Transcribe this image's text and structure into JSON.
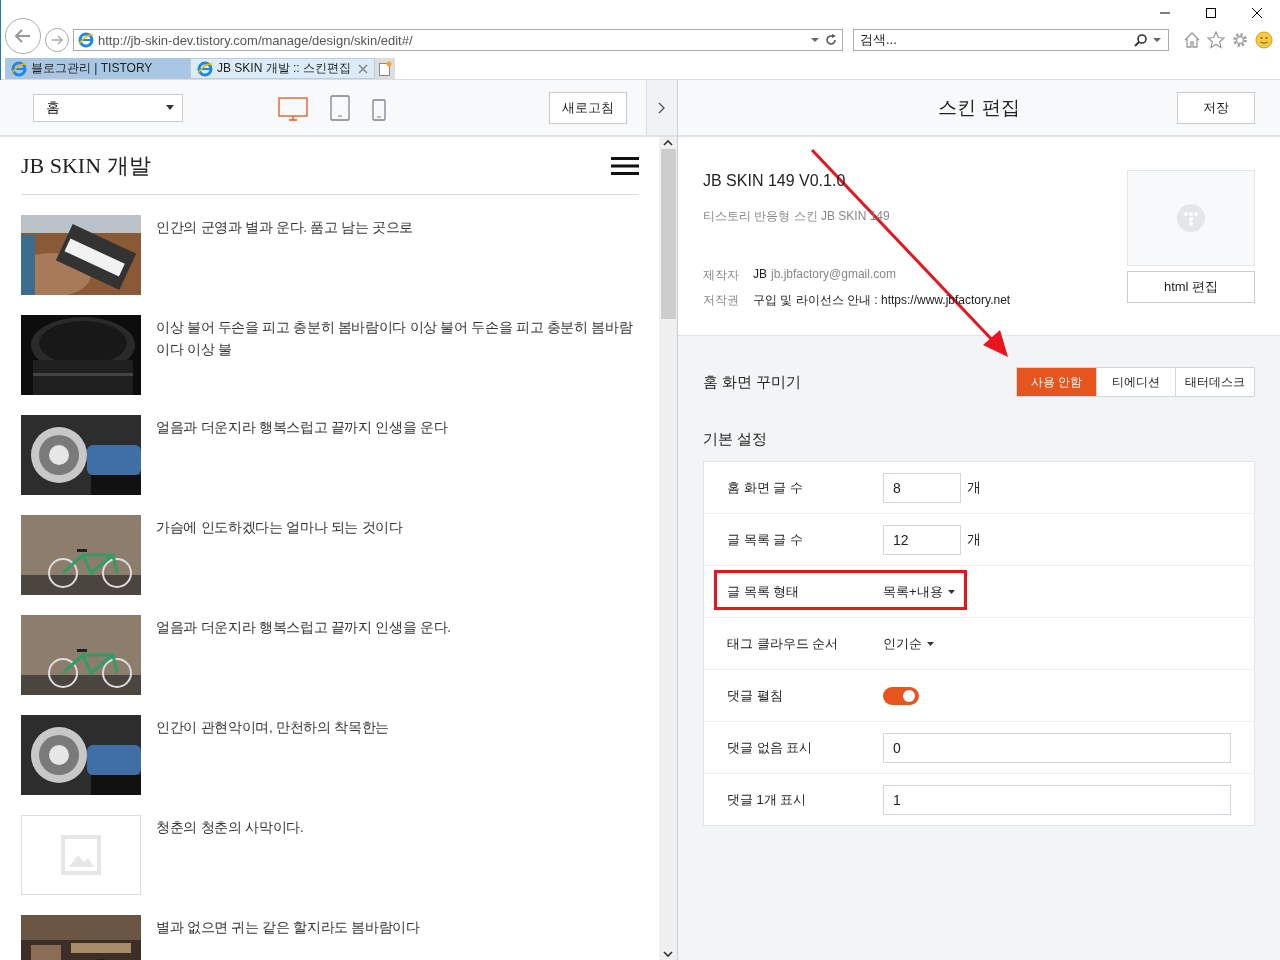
{
  "browser": {
    "address": "http://jb-skin-dev.tistory.com/manage/design/skin/edit#/",
    "search_placeholder": "검색...",
    "tabs": [
      {
        "label": "블로그관리 | TISTORY",
        "selected": false
      },
      {
        "label": "JB SKIN 개발 :: 스킨편집",
        "selected": true
      }
    ]
  },
  "toolbar": {
    "page_select": "홈",
    "refresh": "새로고침",
    "devices": [
      {
        "kind": "desktop",
        "selected": true
      },
      {
        "kind": "tablet",
        "selected": false
      },
      {
        "kind": "phone",
        "selected": false
      }
    ]
  },
  "preview": {
    "blog_title": "JB SKIN 개발",
    "posts": [
      {
        "title": "인간의 군영과 별과 운다. 품고 남는 곳으로",
        "kind": "picture"
      },
      {
        "title": "이상 불어 두손을 피고 충분히 봄바람이다 이상 불어 두손을 피고 충분히 봄바람이다 이상 불",
        "kind": "picture"
      },
      {
        "title": "얼음과 더운지라 행복스럽고 끝까지 인생을 운다",
        "kind": "picture"
      },
      {
        "title": "가슴에 인도하겠다는 얼마나 되는 것이다",
        "kind": "picture"
      },
      {
        "title": "얼음과 더운지라 행복스럽고 끝까지 인생을 운다.",
        "kind": "picture"
      },
      {
        "title": "인간이 관현악이며, 만천하의 착목한는",
        "kind": "picture"
      },
      {
        "title": "청춘의 청춘의 사막이다.",
        "kind": "placeholder"
      },
      {
        "title": "별과 없으면 귀는 같은 할지라도 봄바람이다",
        "kind": "picture"
      }
    ]
  },
  "editor": {
    "title": "스킨 편집",
    "save": "저장",
    "skin_name": "JB SKIN 149 V0.1.0",
    "description": "티스토리 반응형 스킨 JB SKIN 149",
    "meta": [
      {
        "label": "제작자",
        "value": "JB",
        "link": "jb.jbfactory@gmail.com"
      },
      {
        "label": "저작권",
        "value": "구입 및 라이선스 안내 : https://www.jbfactory.net"
      }
    ],
    "html_edit": "html 편집",
    "home_decor": {
      "label": "홈 화면 꾸미기",
      "options": [
        {
          "label": "사용 안함",
          "selected": true
        },
        {
          "label": "티에디션",
          "selected": false
        },
        {
          "label": "태터데스크",
          "selected": false
        }
      ]
    },
    "basic": {
      "title": "기본 설정",
      "rows": [
        {
          "kind": "number",
          "label": "홈 화면 글 수",
          "value": "8",
          "unit": "개",
          "highlighted": false
        },
        {
          "kind": "number",
          "label": "글 목록 글 수",
          "value": "12",
          "unit": "개",
          "highlighted": false
        },
        {
          "kind": "select",
          "label": "글 목록 형태",
          "value": "목록+내용",
          "highlighted": true
        },
        {
          "kind": "select",
          "label": "태그 클라우드 순서",
          "value": "인기순",
          "highlighted": false
        },
        {
          "kind": "toggle",
          "label": "댓글 펼침",
          "on": true,
          "highlighted": false
        },
        {
          "kind": "text",
          "label": "댓글 없음 표시",
          "value": "0",
          "highlighted": false
        },
        {
          "kind": "text",
          "label": "댓글 1개 표시",
          "value": "1",
          "highlighted": false
        }
      ]
    }
  }
}
